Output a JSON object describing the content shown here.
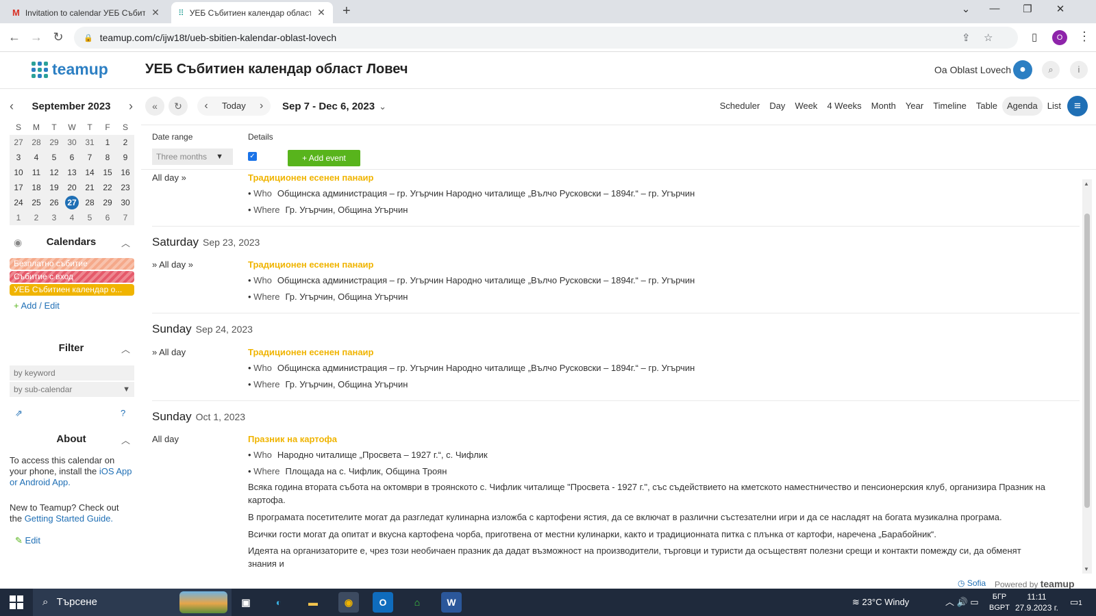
{
  "browser": {
    "tabs": [
      {
        "title": "Invitation to calendar УЕБ Събитие",
        "favicon": "gmail-icon"
      },
      {
        "title": "УЕБ Събитиен календар област",
        "favicon": "teamup-icon"
      }
    ],
    "url": "teamup.com/c/ijw18t/ueb-sbitien-kalendar-oblast-lovech",
    "profile_initial": "O"
  },
  "header": {
    "logo_text": "teamup",
    "calendar_title": "УЕБ Събитиен календар област Ловеч",
    "user_name": "Oa Oblast Lovech"
  },
  "mini_calendar": {
    "month_label": "September 2023",
    "weekdays": [
      "S",
      "M",
      "T",
      "W",
      "T",
      "F",
      "S"
    ],
    "weeks": [
      [
        "27",
        "28",
        "29",
        "30",
        "31",
        "1",
        "2"
      ],
      [
        "3",
        "4",
        "5",
        "6",
        "7",
        "8",
        "9"
      ],
      [
        "10",
        "11",
        "12",
        "13",
        "14",
        "15",
        "16"
      ],
      [
        "17",
        "18",
        "19",
        "20",
        "21",
        "22",
        "23"
      ],
      [
        "24",
        "25",
        "26",
        "27",
        "28",
        "29",
        "30"
      ],
      [
        "1",
        "2",
        "3",
        "4",
        "5",
        "6",
        "7"
      ]
    ],
    "today": "27"
  },
  "sidebar": {
    "calendars_label": "Calendars",
    "subcalendars": [
      {
        "name": "Безплатно събитие"
      },
      {
        "name": "Събитие с вход"
      },
      {
        "name": "УЕБ Събитиен календар о..."
      }
    ],
    "add_edit": "Add / Edit",
    "filter_label": "Filter",
    "keyword_placeholder": "by keyword",
    "subcal_placeholder": "by sub-calendar",
    "about_label": "About",
    "about_text_1": "To access this calendar on your phone, install the ",
    "about_link_1": "iOS App or Android App.",
    "about_text_2": "New to Teamup? Check out the ",
    "about_link_2": "Getting Started Guide.",
    "edit_label": "Edit"
  },
  "toolbar": {
    "today_label": "Today",
    "date_range": "Sep 7 - Dec 6, 2023",
    "views": [
      "Scheduler",
      "Day",
      "Week",
      "4 Weeks",
      "Month",
      "Year",
      "Timeline",
      "Table",
      "Agenda",
      "List"
    ],
    "active_view": "Agenda"
  },
  "options": {
    "date_range_label": "Date range",
    "date_range_value": "Three months",
    "details_label": "Details",
    "details_checked": true,
    "add_event_label": "+ Add event"
  },
  "agenda": {
    "who_label": "Who",
    "where_label": "Where",
    "days": [
      {
        "weekday": "",
        "date": "",
        "time": "All day »",
        "title": "Традиционен есенен панаир",
        "who": "Общинска администрация – гр. Угърчин Народно читалище „Вълчо Русковски – 1894г.“ – гр. Угърчин",
        "where": "Гр. Угърчин, Община Угърчин"
      },
      {
        "weekday": "Saturday",
        "date": "Sep 23, 2023",
        "time": "» All day »",
        "title": "Традиционен есенен панаир",
        "who": "Общинска администрация – гр. Угърчин Народно читалище „Вълчо Русковски – 1894г.“ – гр. Угърчин",
        "where": "Гр. Угърчин, Община Угърчин"
      },
      {
        "weekday": "Sunday",
        "date": "Sep 24, 2023",
        "time": "» All day",
        "title": "Традиционен есенен панаир",
        "who": "Общинска администрация – гр. Угърчин Народно читалище „Вълчо Русковски – 1894г.“ – гр. Угърчин",
        "where": "Гр. Угърчин, Община Угърчин"
      },
      {
        "weekday": "Sunday",
        "date": "Oct 1, 2023",
        "time": "All day",
        "title": "Празник на картофа",
        "who": "Народно читалище „Просвета – 1927 г.“, с. Чифлик",
        "where": "Площада на с. Чифлик, Община Троян",
        "description": [
          "Всяка година втората събота на октомври в троянското с. Чифлик читалище \"Просвета - 1927 г.\", със съдействието на кметското наместничество и пенсионерския клуб, организира Празник на картофа.",
          "В програмата посетителите могат да разгледат кулинарна изложба с картофени ястия, да се включат в различни състезателни игри и да се насладят на богата музикална програма.",
          "Всички гости могат да опитат и вкусна картофена чорба, приготвена от местни кулинарки, както и традиционната питка с плънка от картофи, наречена „Барабойник“.",
          "Идеята на организаторите е, чрез този необичаен празник да дадат възможност на производители, търговци и туристи да осъществят полезни срещи и контакти помежду си, да обменят знания и"
        ]
      }
    ]
  },
  "footer": {
    "timezone": "Sofia",
    "powered_by": "Powered by",
    "brand": "teamup"
  },
  "taskbar": {
    "search_placeholder": "Търсене",
    "weather": "23°C  Windy",
    "lang_1": "БГР",
    "lang_2": "BGPT",
    "time": "11:11",
    "date": "27.9.2023 г.",
    "notifications": "1"
  }
}
